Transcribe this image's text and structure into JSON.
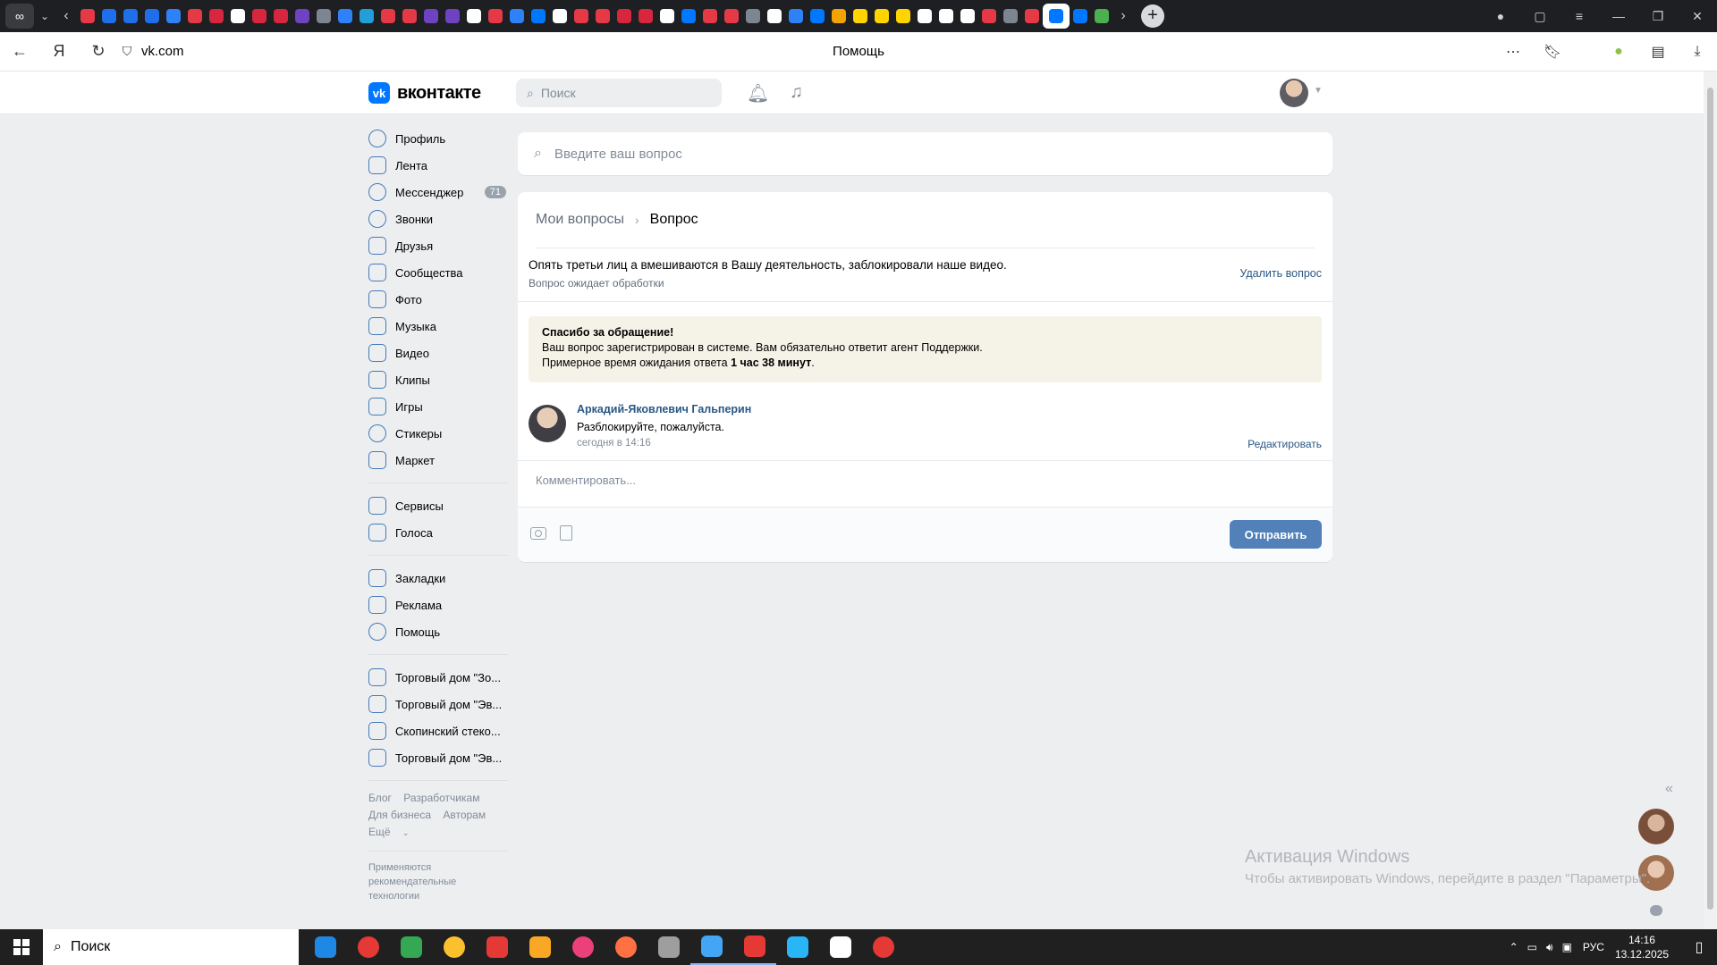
{
  "browser": {
    "url": "vk.com",
    "page_title": "Помощь",
    "fav_colors": [
      "#e63946",
      "#1f6feb",
      "#1f6feb",
      "#1f6feb",
      "#2f81f7",
      "#e63946",
      "#d7263d",
      "#ffffff",
      "#d7263d",
      "#d7263d",
      "#6f42c1",
      "#7d8590",
      "#2f81f7",
      "#229ed9",
      "#e63946",
      "#e63946",
      "#6f42c1",
      "#6f42c1",
      "#ffffff",
      "#e63946",
      "#2f81f7",
      "#0077ff",
      "#ffffff",
      "#e63946",
      "#e63946",
      "#d7263d",
      "#d7263d",
      "#ffffff",
      "#0077ff",
      "#e63946",
      "#e63946",
      "#7d8590",
      "#ffffff",
      "#2f81f7",
      "#0077ff",
      "#f4a300",
      "#ffd400",
      "#ffd400",
      "#ffd400",
      "#ffffff",
      "#ffffff",
      "#ffffff",
      "#e63946",
      "#7d8590",
      "#e63946",
      "#0077ff",
      "#0077ff",
      "#4caf50"
    ]
  },
  "vk": {
    "logo_text": "вконтакте",
    "search_placeholder": "Поиск"
  },
  "nav": {
    "main": [
      {
        "label": "Профиль",
        "icon": "profile-icon"
      },
      {
        "label": "Лента",
        "icon": "feed-icon"
      },
      {
        "label": "Мессенджер",
        "icon": "messenger-icon",
        "badge": "71"
      },
      {
        "label": "Звонки",
        "icon": "phone-icon"
      },
      {
        "label": "Друзья",
        "icon": "friends-icon"
      },
      {
        "label": "Сообщества",
        "icon": "communities-icon"
      },
      {
        "label": "Фото",
        "icon": "photo-icon"
      },
      {
        "label": "Музыка",
        "icon": "music-icon"
      },
      {
        "label": "Видео",
        "icon": "video-icon"
      },
      {
        "label": "Клипы",
        "icon": "clips-icon"
      },
      {
        "label": "Игры",
        "icon": "games-icon"
      },
      {
        "label": "Стикеры",
        "icon": "stickers-icon"
      },
      {
        "label": "Маркет",
        "icon": "market-icon"
      }
    ],
    "services": [
      {
        "label": "Сервисы",
        "icon": "services-icon"
      },
      {
        "label": "Голоса",
        "icon": "votes-icon"
      }
    ],
    "extra": [
      {
        "label": "Закладки",
        "icon": "bookmark-icon"
      },
      {
        "label": "Реклама",
        "icon": "ads-icon"
      },
      {
        "label": "Помощь",
        "icon": "help-icon"
      }
    ],
    "groups": [
      {
        "label": "Торговый дом \"Зо...",
        "icon": "group-icon"
      },
      {
        "label": "Торговый дом \"Эв...",
        "icon": "group-icon"
      },
      {
        "label": "Скопинский стеко...",
        "icon": "group-icon"
      },
      {
        "label": "Торговый дом \"Эв...",
        "icon": "group-icon"
      }
    ],
    "footer": {
      "blog": "Блог",
      "developers": "Разработчикам",
      "business": "Для бизнеса",
      "authors": "Авторам",
      "more": "Ещё",
      "note": "Применяются рекомендательные технологии"
    }
  },
  "help": {
    "question_placeholder": "Введите ваш вопрос",
    "breadcrumb_my": "Мои вопросы",
    "breadcrumb_current": "Вопрос",
    "question_text": "Опять третьи лиц а вмешиваются в Вашу деятельность, заблокировали наше видео.",
    "question_status": "Вопрос ожидает обработки",
    "delete_label": "Удалить вопрос",
    "notice_title": "Спасибо за обращение!",
    "notice_line1": "Ваш вопрос зарегистрирован в системе. Вам обязательно ответит агент Поддержки.",
    "notice_line2_prefix": "Примерное время ожидания ответа ",
    "notice_wait": "1 час 38 минут",
    "notice_line2_suffix": ".",
    "message": {
      "author": "Аркадий-Яковлевич Гальперин",
      "text": "Разблокируйте, пожалуйста.",
      "time": "сегодня в 14:16",
      "edit_label": "Редактировать"
    },
    "comment_placeholder": "Комментировать...",
    "send_label": "Отправить"
  },
  "windows": {
    "activation_title": "Активация Windows",
    "activation_text": "Чтобы активировать Windows, перейдите в раздел \"Параметры\".",
    "search_label": "Поиск",
    "lang": "РУС",
    "time": "14:16",
    "date": "13.12.2025",
    "taskbar_colors": [
      "#1e88e5",
      "#e53935",
      "#34a853",
      "#fbc02d",
      "#e53935",
      "#f9a825",
      "#ec407a",
      "#ff7043",
      "#9e9e9e",
      "#42a5f5",
      "#e53935",
      "#29b6f6",
      "#ffffff",
      "#e53935"
    ]
  }
}
